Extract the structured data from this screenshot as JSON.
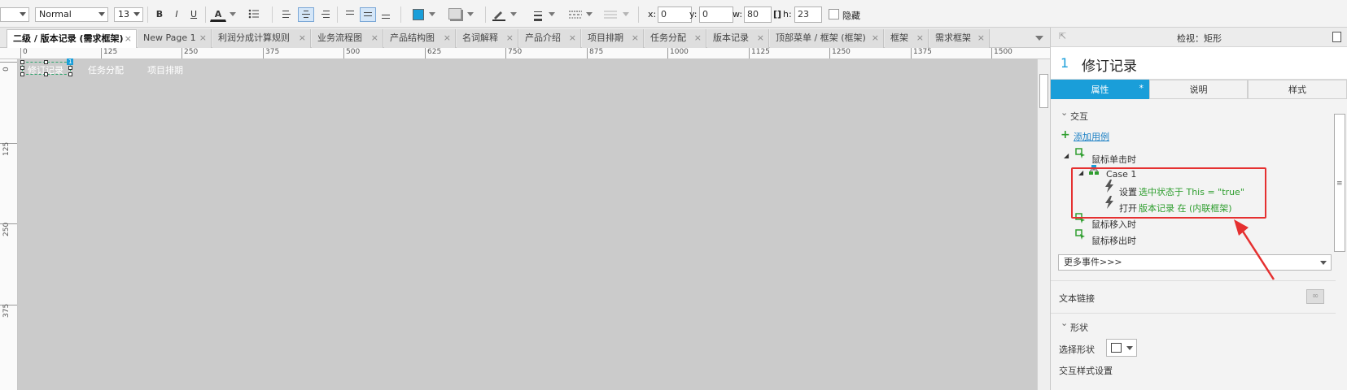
{
  "toolbar": {
    "style_value": "Normal",
    "font_size": "13",
    "bold": "B",
    "italic": "I",
    "underline": "U",
    "font_color_glyph": "A",
    "x_label": "x:",
    "x_value": "0",
    "y_label": "y:",
    "y_value": "0",
    "w_label": "w:",
    "w_value": "80",
    "h_label": "h:",
    "h_value": "23",
    "hidden_label": "隐藏",
    "fill_color": "#1a9ed9"
  },
  "tabs": [
    {
      "label": "二级 / 版本记录 (需求框架)",
      "active": true
    },
    {
      "label": "New Page 1"
    },
    {
      "label": "利润分成计算规则"
    },
    {
      "label": "业务流程图"
    },
    {
      "label": "产品结构图"
    },
    {
      "label": "名词解释"
    },
    {
      "label": "产品介绍"
    },
    {
      "label": "项目排期"
    },
    {
      "label": "任务分配"
    },
    {
      "label": "版本记录"
    },
    {
      "label": "顶部菜单 / 框架 (框架)"
    },
    {
      "label": "框架"
    },
    {
      "label": "需求框架"
    }
  ],
  "ruler": {
    "h": [
      "0",
      "125",
      "250",
      "375",
      "500",
      "625",
      "750",
      "875",
      "1000",
      "1125",
      "1250",
      "1375",
      "1500"
    ],
    "v": [
      "0",
      "125",
      "250",
      "375"
    ]
  },
  "canvas": {
    "items": [
      "修订记录",
      "任务分配",
      "项目排期"
    ],
    "badge": "1"
  },
  "inspector": {
    "title": "检视：矩形",
    "widget_index": "1",
    "widget_name": "修订记录",
    "tabs": [
      "属性",
      "说明",
      "样式"
    ],
    "tab_star": "*",
    "section_interaction": "交互",
    "add_case": "添加用例",
    "event_click": "鼠标单击时",
    "case_name": "Case 1",
    "action1_verb": "设置",
    "action1_detail": "选中状态于 This = \"true\"",
    "action2_verb": "打开",
    "action2_detail": "版本记录 在 (内联框架)",
    "event_enter": "鼠标移入时",
    "event_leave": "鼠标移出时",
    "more_events": "更多事件>>>",
    "text_link": "文本链接",
    "section_shape": "形状",
    "select_shape": "选择形状",
    "interaction_style": "交互样式设置",
    "highlight_color": "#e53030"
  }
}
